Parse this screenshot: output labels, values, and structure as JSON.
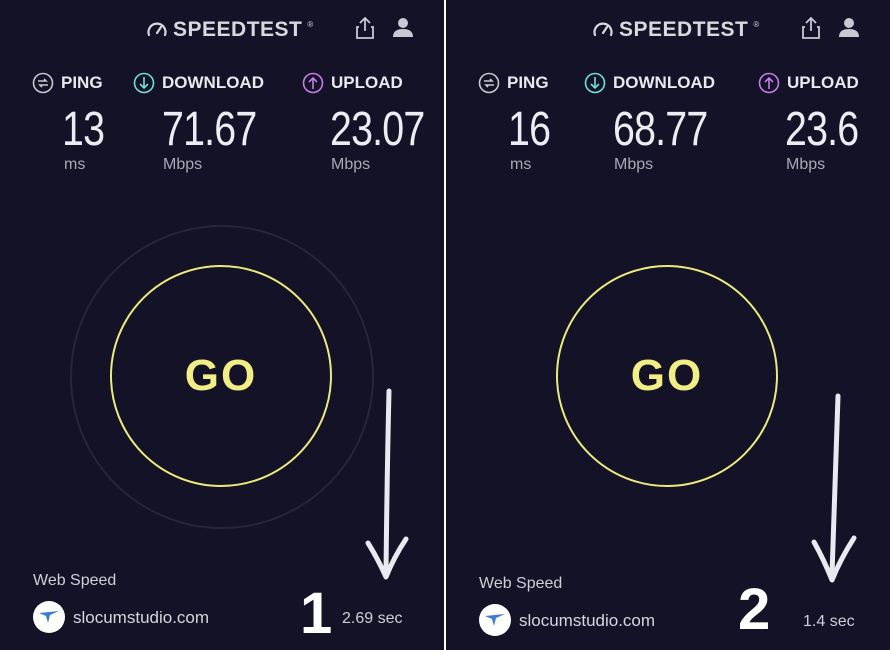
{
  "app": {
    "brand": "SPEEDTEST",
    "trademark": "®"
  },
  "panels": [
    {
      "ping": {
        "label": "PING",
        "value": "13",
        "unit": "ms"
      },
      "download": {
        "label": "DOWNLOAD",
        "value": "71.67",
        "unit": "Mbps"
      },
      "upload": {
        "label": "UPLOAD",
        "value": "23.07",
        "unit": "Mbps"
      },
      "go_label": "GO",
      "web_speed": {
        "label": "Web Speed",
        "site": "slocumstudio.com",
        "time": "2.69 sec"
      },
      "number": "1"
    },
    {
      "ping": {
        "label": "PING",
        "value": "16",
        "unit": "ms"
      },
      "download": {
        "label": "DOWNLOAD",
        "value": "68.77",
        "unit": "Mbps"
      },
      "upload": {
        "label": "UPLOAD",
        "value": "23.6",
        "unit": "Mbps"
      },
      "go_label": "GO",
      "web_speed": {
        "label": "Web Speed",
        "site": "slocumstudio.com",
        "time": "1.4 sec"
      },
      "number": "2"
    }
  ],
  "icons": {
    "brand": "speedometer-icon",
    "share": "share-icon",
    "profile": "profile-icon",
    "ping": "ping-icon",
    "download": "download-icon",
    "upload": "upload-icon",
    "site_logo": "bird-logo-icon",
    "arrow": "down-arrow-icon"
  },
  "colors": {
    "background": "#131226",
    "go_accent": "#ecea7c",
    "ping": "#c8c8cf",
    "download": "#6fe3d5",
    "upload": "#c57ee6",
    "site_logo": "#3a7bd5"
  }
}
